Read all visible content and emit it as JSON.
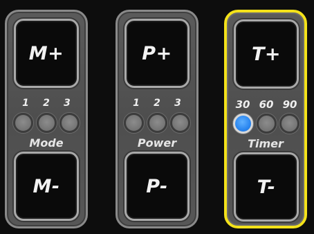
{
  "panels": [
    {
      "increase_label": "M+",
      "decrease_label": "M-",
      "levels": [
        "1",
        "2",
        "3"
      ],
      "caption": "Mode"
    },
    {
      "increase_label": "P+",
      "decrease_label": "P-",
      "levels": [
        "1",
        "2",
        "3"
      ],
      "caption": "Power"
    },
    {
      "increase_label": "T+",
      "decrease_label": "T-",
      "levels": [
        "30",
        "60",
        "90"
      ],
      "caption": "Timer",
      "active_level": "30",
      "highlighted": true
    }
  ],
  "colors": {
    "background": "#0d0d0d",
    "panel": "#555555",
    "highlight_border": "#f4e21a",
    "active_indicator": "#2a86f0",
    "inactive_indicator": "#7a7a7a"
  }
}
